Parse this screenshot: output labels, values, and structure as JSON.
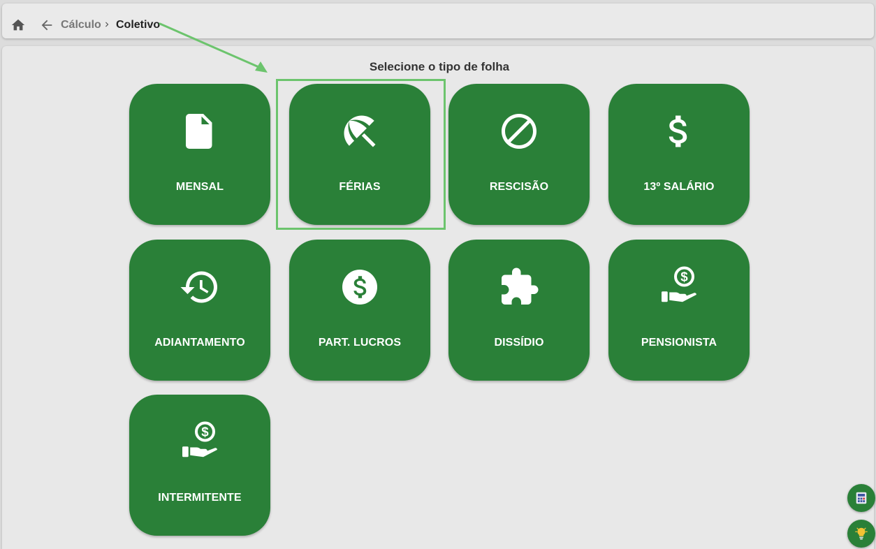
{
  "breadcrumb": {
    "parent": "Cálculo",
    "current": "Coletivo"
  },
  "page": {
    "title": "Selecione o tipo de folha"
  },
  "tiles": [
    {
      "label": "MENSAL",
      "icon": "document-icon"
    },
    {
      "label": "FÉRIAS",
      "icon": "beach-umbrella-icon"
    },
    {
      "label": "RESCISÃO",
      "icon": "block-icon"
    },
    {
      "label": "13º SALÁRIO",
      "icon": "dollar-icon"
    },
    {
      "label": "ADIANTAMENTO",
      "icon": "history-icon"
    },
    {
      "label": "PART. LUCROS",
      "icon": "dollar-circle-icon"
    },
    {
      "label": "DISSÍDIO",
      "icon": "puzzle-icon"
    },
    {
      "label": "PENSIONISTA",
      "icon": "hand-coin-icon"
    },
    {
      "label": "INTERMITENTE",
      "icon": "hand-coin-icon"
    }
  ],
  "colors": {
    "tile": "#2a8038",
    "highlight": "#6cc46d",
    "background": "#e8e8e8"
  }
}
